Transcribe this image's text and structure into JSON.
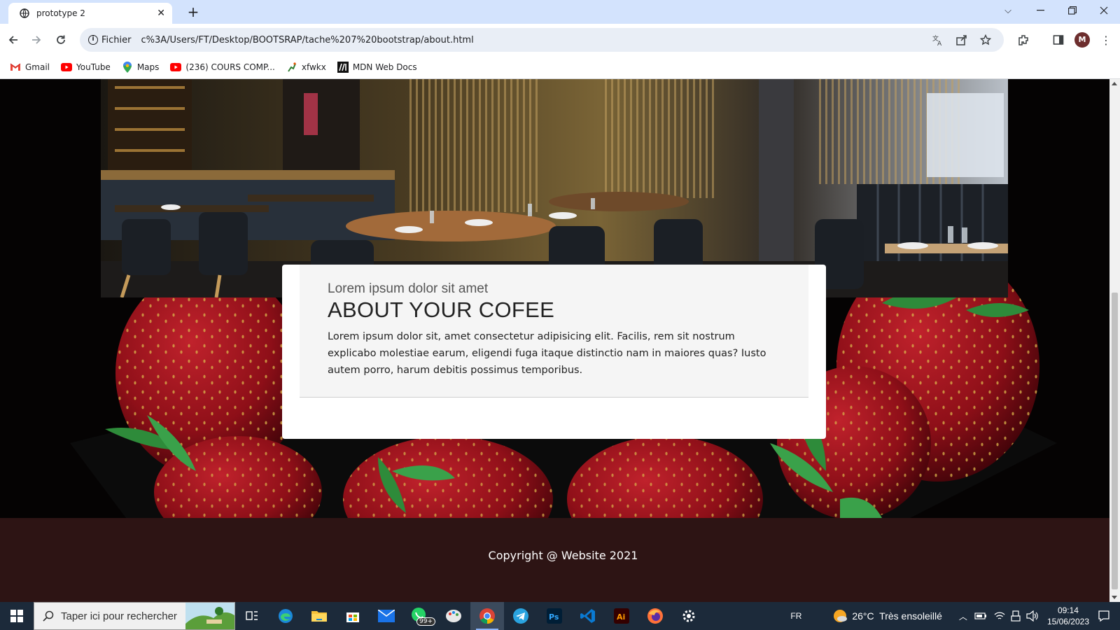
{
  "browser": {
    "tab_title": "prototype 2",
    "url_chip": "Fichier",
    "url": "c%3A/Users/FT/Desktop/BOOTSRAP/tache%207%20bootstrap/about.html",
    "profile_initial": "M",
    "bookmarks": [
      {
        "label": "Gmail",
        "icon": "gmail-icon"
      },
      {
        "label": "YouTube",
        "icon": "youtube-icon"
      },
      {
        "label": "Maps",
        "icon": "maps-icon"
      },
      {
        "label": "(236) COURS COMP...",
        "icon": "youtube-icon"
      },
      {
        "label": "xfwkx",
        "icon": "figure-icon"
      },
      {
        "label": "MDN Web Docs",
        "icon": "mdn-icon"
      }
    ]
  },
  "page": {
    "about": {
      "subheading": "Lorem ipsum dolor sit amet",
      "heading": "ABOUT YOUR COFEE",
      "body": "Lorem ipsum dolor sit, amet consectetur adipisicing elit. Facilis, rem sit nostrum explicabo molestiae earum, eligendi fuga itaque distinctio nam in maiores quas? Iusto autem porro, harum debitis possimus temporibus."
    },
    "footer": "Copyright @ Website 2021"
  },
  "taskbar": {
    "search_placeholder": "Taper ici pour rechercher",
    "language": "FR",
    "weather": "26°C  Très ensoleillé",
    "time": "09:14",
    "date": "15/06/2023",
    "whatsapp_badge": "99+"
  },
  "colors": {
    "footer_bg": "#2d1414",
    "tabbar_bg": "#d3e3fd",
    "taskbar_bg": "#1c2a3a"
  }
}
